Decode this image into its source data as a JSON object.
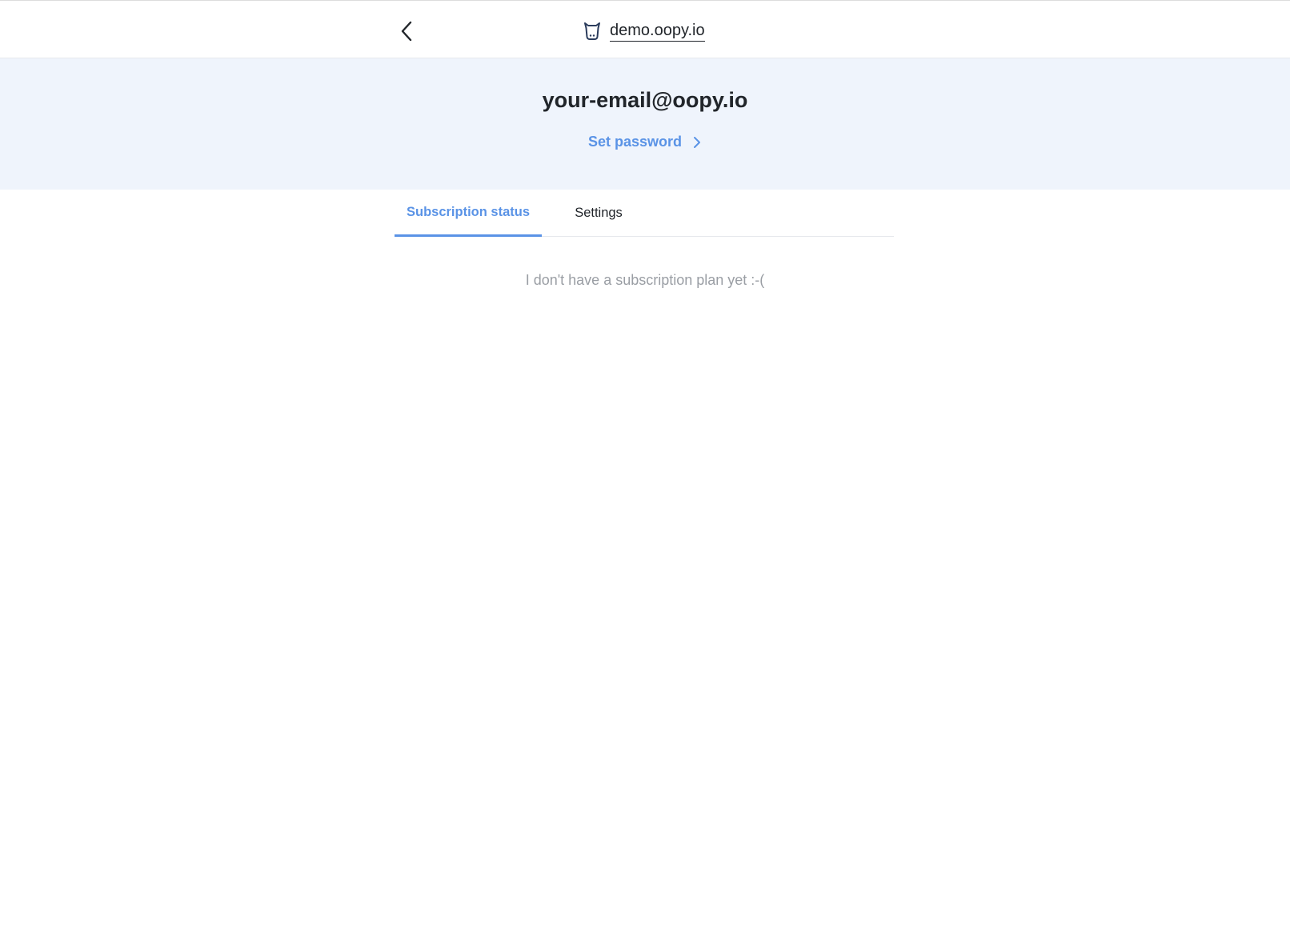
{
  "header": {
    "back_icon": "chevron-left-icon",
    "site_icon": "cow-logo-icon",
    "site_name": "demo.oopy.io"
  },
  "profile": {
    "email": "your-email@oopy.io",
    "set_password_label": "Set password",
    "set_password_icon": "chevron-right-icon"
  },
  "tabs": [
    {
      "label": "Subscription status",
      "active": true
    },
    {
      "label": "Settings",
      "active": false
    }
  ],
  "subscription": {
    "empty_message": "I don't have a subscription plan yet :-("
  },
  "colors": {
    "accent": "#5a93e6",
    "banner_bg": "#eff4fc",
    "text_dark": "#21252a",
    "text_muted": "#9a9ea4"
  }
}
